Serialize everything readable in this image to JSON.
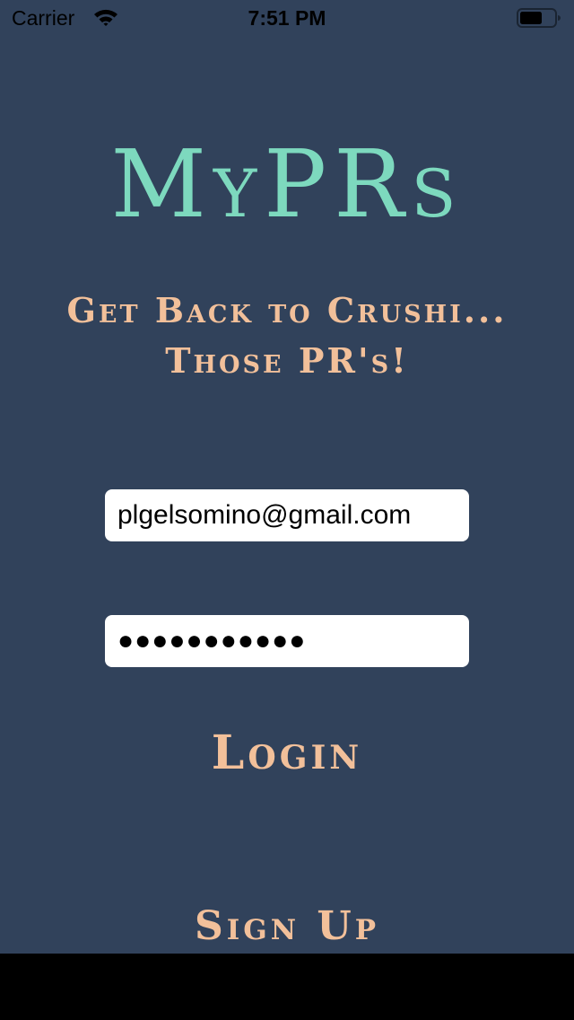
{
  "status_bar": {
    "carrier": "Carrier",
    "time": "7:51 PM",
    "wifi_icon": "wifi-icon",
    "battery_icon": "battery-icon"
  },
  "branding": {
    "title": "MyPRs",
    "tagline_line1": "Get Back to Crushi...",
    "tagline_line2": "Those PR's!"
  },
  "login_form": {
    "email_value": "plgelsomino@gmail.com",
    "password_value": "●●●●●●●●●●●",
    "login_label": "Login",
    "signup_label": "Sign Up"
  },
  "colors": {
    "background": "#31425B",
    "title": "#7DD9BE",
    "accent": "#F2C09A",
    "field_background": "#FFFFFF"
  }
}
